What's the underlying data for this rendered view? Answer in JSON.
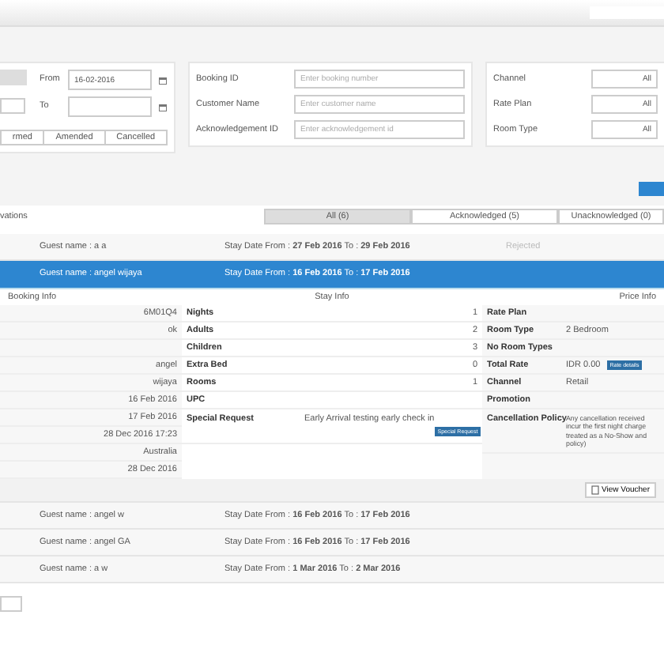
{
  "date_filter": {
    "from": {
      "label": "From",
      "value": "16-02-2016"
    },
    "to": {
      "label": "To"
    },
    "status_buttons": [
      "rmed",
      "Amended",
      "Cancelled"
    ]
  },
  "search_fields": [
    {
      "label": "Booking ID",
      "placeholder": "Enter booking number"
    },
    {
      "label": "Customer Name",
      "placeholder": "Enter customer name"
    },
    {
      "label": "Acknowledgement ID",
      "placeholder": "Enter acknowledgement id"
    }
  ],
  "selects": [
    {
      "label": "Channel",
      "value": "All"
    },
    {
      "label": "Rate Plan",
      "value": "All"
    },
    {
      "label": "Room Type",
      "value": "All"
    }
  ],
  "list_title": "vations",
  "tabs": [
    {
      "label": "All (6)",
      "selected": true
    },
    {
      "label": "Acknowledged (5)",
      "selected": false
    },
    {
      "label": "Unacknowledged (0)",
      "selected": false
    }
  ],
  "bookings": [
    {
      "guest": "Guest name : a a",
      "stay": "Stay Date From : **27 Feb 2016** To : **29 Feb 2016**",
      "status": "Rejected",
      "selected": false
    },
    {
      "guest": "Guest name : angel wijaya",
      "stay": "Stay Date From : **16 Feb 2016** To : **17 Feb 2016**",
      "selected": true
    },
    {
      "guest": "Guest name : angel w",
      "stay": "Stay Date From : **16 Feb 2016** To : **17 Feb 2016**",
      "selected": false
    },
    {
      "guest": "Guest name : angel GA",
      "stay": "Stay Date From : **16 Feb 2016** To : **17 Feb 2016**",
      "selected": false
    },
    {
      "guest": "Guest name : a w",
      "stay": "Stay Date From : **1 Mar 2016** To : **2 Mar 2016**",
      "selected": false
    }
  ],
  "detail": {
    "headers": [
      "Booking Info",
      "Stay Info",
      "Price Info"
    ],
    "booking_rows": [
      {
        "value": "6M01Q4"
      },
      {
        "value": "ok"
      },
      {},
      {
        "value": "angel"
      },
      {
        "value": "wijaya"
      },
      {
        "value": "16 Feb 2016"
      },
      {
        "value": "17 Feb 2016"
      },
      {
        "value": "28 Dec 2016 17:23"
      },
      {
        "value": "Australia"
      },
      {
        "value": "28 Dec 2016"
      }
    ],
    "stay_rows": [
      {
        "label": "Nights",
        "value": "1"
      },
      {
        "label": "Adults",
        "value": "2"
      },
      {
        "label": "Children",
        "value": "3"
      },
      {
        "label": "Extra Bed",
        "value": "0"
      },
      {
        "label": "Rooms",
        "value": "1"
      },
      {
        "label": "UPC"
      },
      {
        "label": "Special Request",
        "value": "Early Arrival testing early check in",
        "badge": "Special Request"
      }
    ],
    "price_rows": [
      {
        "label": "Rate Plan"
      },
      {
        "label": "Room Type",
        "value": "2 Bedroom"
      },
      {
        "label": "No Room Types"
      },
      {
        "label": "Total Rate",
        "value": "IDR 0.00",
        "badge": "Rate details"
      },
      {
        "label": "Channel",
        "value": "Retail"
      },
      {
        "label": "Promotion"
      },
      {
        "label": "Cancellation Policy",
        "lines": [
          "Any cancellation received",
          "incur the first night charge",
          "treated as a No-Show and",
          "policy)"
        ]
      }
    ],
    "voucher_button": "View Voucher"
  }
}
